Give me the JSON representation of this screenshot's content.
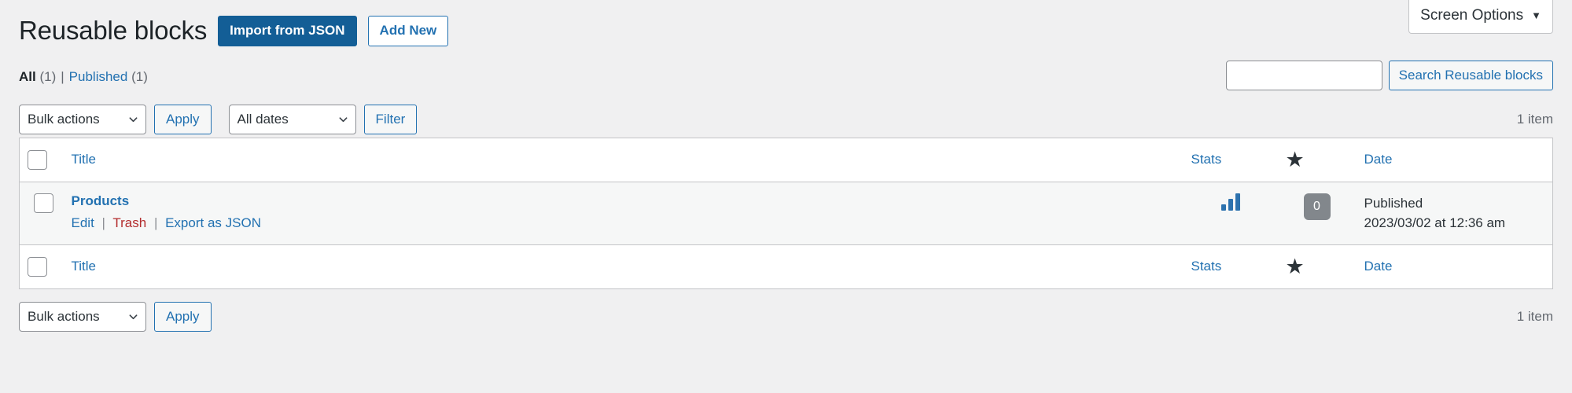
{
  "screen_meta": {
    "screen_options_label": "Screen Options",
    "caret_icon": "chevron-down-icon",
    "caret_glyph": "▼"
  },
  "header": {
    "title": "Reusable blocks",
    "import_button": "Import from JSON",
    "add_new_button": "Add New"
  },
  "views": {
    "all_label": "All",
    "all_count": "(1)",
    "separator": "|",
    "published_label": "Published",
    "published_count": "(1)"
  },
  "search": {
    "value": "",
    "placeholder": "",
    "button_label": "Search Reusable blocks"
  },
  "tablenav_top": {
    "bulk_actions_selected": "Bulk actions",
    "apply_label": "Apply",
    "dates_selected": "All dates",
    "filter_label": "Filter",
    "displaying_num": "1 item",
    "chevron_icon": "chevron-down-icon"
  },
  "tablenav_bottom": {
    "bulk_actions_selected": "Bulk actions",
    "apply_label": "Apply",
    "displaying_num": "1 item",
    "chevron_icon": "chevron-down-icon"
  },
  "table": {
    "columns": {
      "title": "Title",
      "stats": "Stats",
      "star": "star-icon",
      "star_glyph": "★",
      "date": "Date"
    },
    "rows": [
      {
        "title": "Products",
        "actions": {
          "edit": "Edit",
          "divider": "|",
          "trash": "Trash",
          "export": "Export as JSON"
        },
        "stats_icon": "bar-chart-icon",
        "star_count": "0",
        "date_status": "Published",
        "date_value": "2023/03/02 at 12:36 am"
      }
    ]
  },
  "colors": {
    "primary": "#135e96",
    "link": "#2271b1",
    "trash": "#b32d2e",
    "page_bg": "#f0f0f1",
    "row_bg": "#f6f7f7",
    "badge_bg": "#82878c",
    "stats_blue": "#2d72ae"
  }
}
